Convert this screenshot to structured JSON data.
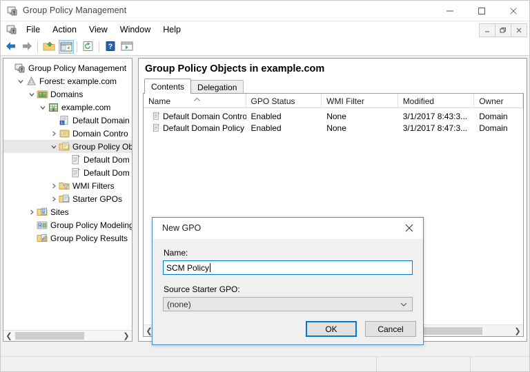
{
  "window": {
    "title": "Group Policy Management",
    "icon": "gpmc-icon",
    "controls": {
      "minimize": "minimize-icon",
      "maximize": "maximize-icon",
      "close": "close-icon"
    }
  },
  "menubar": {
    "icon": "gpmc-small-icon",
    "items": [
      {
        "label": "File",
        "name": "menu-file"
      },
      {
        "label": "Action",
        "name": "menu-action"
      },
      {
        "label": "View",
        "name": "menu-view"
      },
      {
        "label": "Window",
        "name": "menu-window"
      },
      {
        "label": "Help",
        "name": "menu-help"
      }
    ],
    "mdi_controls": {
      "minimize": "mdi-minimize-icon",
      "restore": "mdi-restore-icon",
      "close": "mdi-close-icon"
    }
  },
  "toolbar": {
    "buttons": [
      {
        "name": "back-button",
        "icon": "back-arrow-icon",
        "selected": false
      },
      {
        "name": "forward-button",
        "icon": "forward-arrow-icon",
        "selected": false
      },
      {
        "name": "up-one-level-button",
        "icon": "folder-up-icon",
        "selected": false
      },
      {
        "name": "show-hide-tree-button",
        "icon": "console-tree-icon",
        "selected": true
      },
      {
        "name": "refresh-button",
        "icon": "refresh-icon",
        "selected": false
      },
      {
        "name": "help-button",
        "icon": "help-icon",
        "selected": false
      },
      {
        "name": "properties-button",
        "icon": "properties-icon",
        "selected": false
      }
    ]
  },
  "tree": {
    "items": [
      {
        "label": "Group Policy Management",
        "indent": 0,
        "expander": "none",
        "icon": "gpmc-root-icon",
        "selected": false
      },
      {
        "label": "Forest: example.com",
        "indent": 1,
        "expander": "expanded",
        "icon": "forest-icon",
        "selected": false
      },
      {
        "label": "Domains",
        "indent": 2,
        "expander": "expanded",
        "icon": "domains-icon",
        "selected": false
      },
      {
        "label": "example.com",
        "indent": 3,
        "expander": "expanded",
        "icon": "domain-icon",
        "selected": false
      },
      {
        "label": "Default Domain",
        "indent": 4,
        "expander": "none",
        "icon": "gpo-link-icon",
        "selected": false
      },
      {
        "label": "Domain Contro",
        "indent": 4,
        "expander": "collapsed",
        "icon": "ou-icon",
        "selected": false
      },
      {
        "label": "Group Policy Ob",
        "indent": 4,
        "expander": "expanded",
        "icon": "gpo-container-icon",
        "selected": true
      },
      {
        "label": "Default Dom",
        "indent": 5,
        "expander": "none",
        "icon": "gpo-icon",
        "selected": false
      },
      {
        "label": "Default Dom",
        "indent": 5,
        "expander": "none",
        "icon": "gpo-icon",
        "selected": false
      },
      {
        "label": "WMI Filters",
        "indent": 4,
        "expander": "collapsed",
        "icon": "wmi-filter-icon",
        "selected": false
      },
      {
        "label": "Starter GPOs",
        "indent": 4,
        "expander": "collapsed",
        "icon": "starter-gpo-icon",
        "selected": false
      },
      {
        "label": "Sites",
        "indent": 2,
        "expander": "collapsed",
        "icon": "sites-icon",
        "selected": false
      },
      {
        "label": "Group Policy Modeling",
        "indent": 2,
        "expander": "none",
        "icon": "gp-modeling-icon",
        "selected": false
      },
      {
        "label": "Group Policy Results",
        "indent": 2,
        "expander": "none",
        "icon": "gp-results-icon",
        "selected": false
      }
    ],
    "scrollbar": {
      "left_arrow": "chevron-left-icon",
      "right_arrow": "chevron-right-icon"
    }
  },
  "content": {
    "title": "Group Policy Objects in example.com",
    "tabs": [
      {
        "label": "Contents",
        "active": true
      },
      {
        "label": "Delegation",
        "active": false
      }
    ],
    "table": {
      "columns": [
        "Name",
        "GPO Status",
        "WMI Filter",
        "Modified",
        "Owner"
      ],
      "sorted_column": "Name",
      "sort_indicator": "ascending-sort-icon",
      "rows": [
        {
          "icon": "gpo-icon",
          "Name": "Default Domain Controller...",
          "GPO Status": "Enabled",
          "WMI Filter": "None",
          "Modified": "3/1/2017 8:43:3...",
          "Owner": "Domain"
        },
        {
          "icon": "gpo-icon",
          "Name": "Default Domain Policy",
          "GPO Status": "Enabled",
          "WMI Filter": "None",
          "Modified": "3/1/2017 8:47:3...",
          "Owner": "Domain"
        }
      ]
    },
    "scrollbar": {
      "left_arrow": "chevron-left-icon",
      "right_arrow": "chevron-right-icon"
    }
  },
  "dialog": {
    "title": "New GPO",
    "close_icon": "close-icon",
    "name_label": "Name:",
    "name_value": "SCM Policy",
    "name_placeholder": "",
    "starter_label": "Source Starter GPO:",
    "starter_value": "(none)",
    "starter_options": [
      "(none)"
    ],
    "starter_arrow_icon": "chevron-down-icon",
    "ok_label": "OK",
    "cancel_label": "Cancel"
  },
  "statusbar": {
    "text": ""
  },
  "colors": {
    "accent": "#0078d7",
    "dialog_border": "#3f8fd2",
    "tab_active": "#ffffff",
    "selection": "#e8e8e8",
    "toolbar_selected": "#cde8f7"
  }
}
